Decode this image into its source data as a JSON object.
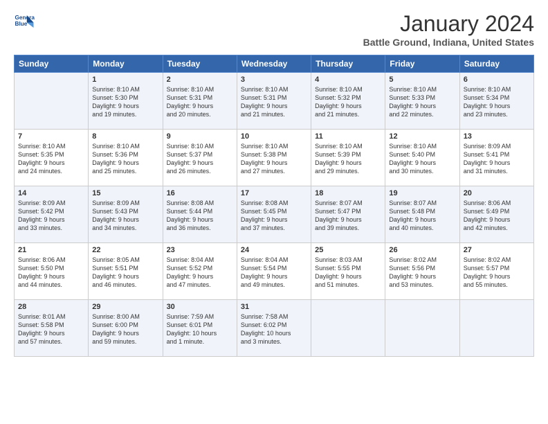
{
  "header": {
    "logo_line1": "General",
    "logo_line2": "Blue",
    "title": "January 2024",
    "location": "Battle Ground, Indiana, United States"
  },
  "days_of_week": [
    "Sunday",
    "Monday",
    "Tuesday",
    "Wednesday",
    "Thursday",
    "Friday",
    "Saturday"
  ],
  "weeks": [
    [
      {
        "day": "",
        "info": ""
      },
      {
        "day": "1",
        "info": "Sunrise: 8:10 AM\nSunset: 5:30 PM\nDaylight: 9 hours\nand 19 minutes."
      },
      {
        "day": "2",
        "info": "Sunrise: 8:10 AM\nSunset: 5:31 PM\nDaylight: 9 hours\nand 20 minutes."
      },
      {
        "day": "3",
        "info": "Sunrise: 8:10 AM\nSunset: 5:31 PM\nDaylight: 9 hours\nand 21 minutes."
      },
      {
        "day": "4",
        "info": "Sunrise: 8:10 AM\nSunset: 5:32 PM\nDaylight: 9 hours\nand 21 minutes."
      },
      {
        "day": "5",
        "info": "Sunrise: 8:10 AM\nSunset: 5:33 PM\nDaylight: 9 hours\nand 22 minutes."
      },
      {
        "day": "6",
        "info": "Sunrise: 8:10 AM\nSunset: 5:34 PM\nDaylight: 9 hours\nand 23 minutes."
      }
    ],
    [
      {
        "day": "7",
        "info": "Sunrise: 8:10 AM\nSunset: 5:35 PM\nDaylight: 9 hours\nand 24 minutes."
      },
      {
        "day": "8",
        "info": "Sunrise: 8:10 AM\nSunset: 5:36 PM\nDaylight: 9 hours\nand 25 minutes."
      },
      {
        "day": "9",
        "info": "Sunrise: 8:10 AM\nSunset: 5:37 PM\nDaylight: 9 hours\nand 26 minutes."
      },
      {
        "day": "10",
        "info": "Sunrise: 8:10 AM\nSunset: 5:38 PM\nDaylight: 9 hours\nand 27 minutes."
      },
      {
        "day": "11",
        "info": "Sunrise: 8:10 AM\nSunset: 5:39 PM\nDaylight: 9 hours\nand 29 minutes."
      },
      {
        "day": "12",
        "info": "Sunrise: 8:10 AM\nSunset: 5:40 PM\nDaylight: 9 hours\nand 30 minutes."
      },
      {
        "day": "13",
        "info": "Sunrise: 8:09 AM\nSunset: 5:41 PM\nDaylight: 9 hours\nand 31 minutes."
      }
    ],
    [
      {
        "day": "14",
        "info": "Sunrise: 8:09 AM\nSunset: 5:42 PM\nDaylight: 9 hours\nand 33 minutes."
      },
      {
        "day": "15",
        "info": "Sunrise: 8:09 AM\nSunset: 5:43 PM\nDaylight: 9 hours\nand 34 minutes."
      },
      {
        "day": "16",
        "info": "Sunrise: 8:08 AM\nSunset: 5:44 PM\nDaylight: 9 hours\nand 36 minutes."
      },
      {
        "day": "17",
        "info": "Sunrise: 8:08 AM\nSunset: 5:45 PM\nDaylight: 9 hours\nand 37 minutes."
      },
      {
        "day": "18",
        "info": "Sunrise: 8:07 AM\nSunset: 5:47 PM\nDaylight: 9 hours\nand 39 minutes."
      },
      {
        "day": "19",
        "info": "Sunrise: 8:07 AM\nSunset: 5:48 PM\nDaylight: 9 hours\nand 40 minutes."
      },
      {
        "day": "20",
        "info": "Sunrise: 8:06 AM\nSunset: 5:49 PM\nDaylight: 9 hours\nand 42 minutes."
      }
    ],
    [
      {
        "day": "21",
        "info": "Sunrise: 8:06 AM\nSunset: 5:50 PM\nDaylight: 9 hours\nand 44 minutes."
      },
      {
        "day": "22",
        "info": "Sunrise: 8:05 AM\nSunset: 5:51 PM\nDaylight: 9 hours\nand 46 minutes."
      },
      {
        "day": "23",
        "info": "Sunrise: 8:04 AM\nSunset: 5:52 PM\nDaylight: 9 hours\nand 47 minutes."
      },
      {
        "day": "24",
        "info": "Sunrise: 8:04 AM\nSunset: 5:54 PM\nDaylight: 9 hours\nand 49 minutes."
      },
      {
        "day": "25",
        "info": "Sunrise: 8:03 AM\nSunset: 5:55 PM\nDaylight: 9 hours\nand 51 minutes."
      },
      {
        "day": "26",
        "info": "Sunrise: 8:02 AM\nSunset: 5:56 PM\nDaylight: 9 hours\nand 53 minutes."
      },
      {
        "day": "27",
        "info": "Sunrise: 8:02 AM\nSunset: 5:57 PM\nDaylight: 9 hours\nand 55 minutes."
      }
    ],
    [
      {
        "day": "28",
        "info": "Sunrise: 8:01 AM\nSunset: 5:58 PM\nDaylight: 9 hours\nand 57 minutes."
      },
      {
        "day": "29",
        "info": "Sunrise: 8:00 AM\nSunset: 6:00 PM\nDaylight: 9 hours\nand 59 minutes."
      },
      {
        "day": "30",
        "info": "Sunrise: 7:59 AM\nSunset: 6:01 PM\nDaylight: 10 hours\nand 1 minute."
      },
      {
        "day": "31",
        "info": "Sunrise: 7:58 AM\nSunset: 6:02 PM\nDaylight: 10 hours\nand 3 minutes."
      },
      {
        "day": "",
        "info": ""
      },
      {
        "day": "",
        "info": ""
      },
      {
        "day": "",
        "info": ""
      }
    ]
  ]
}
